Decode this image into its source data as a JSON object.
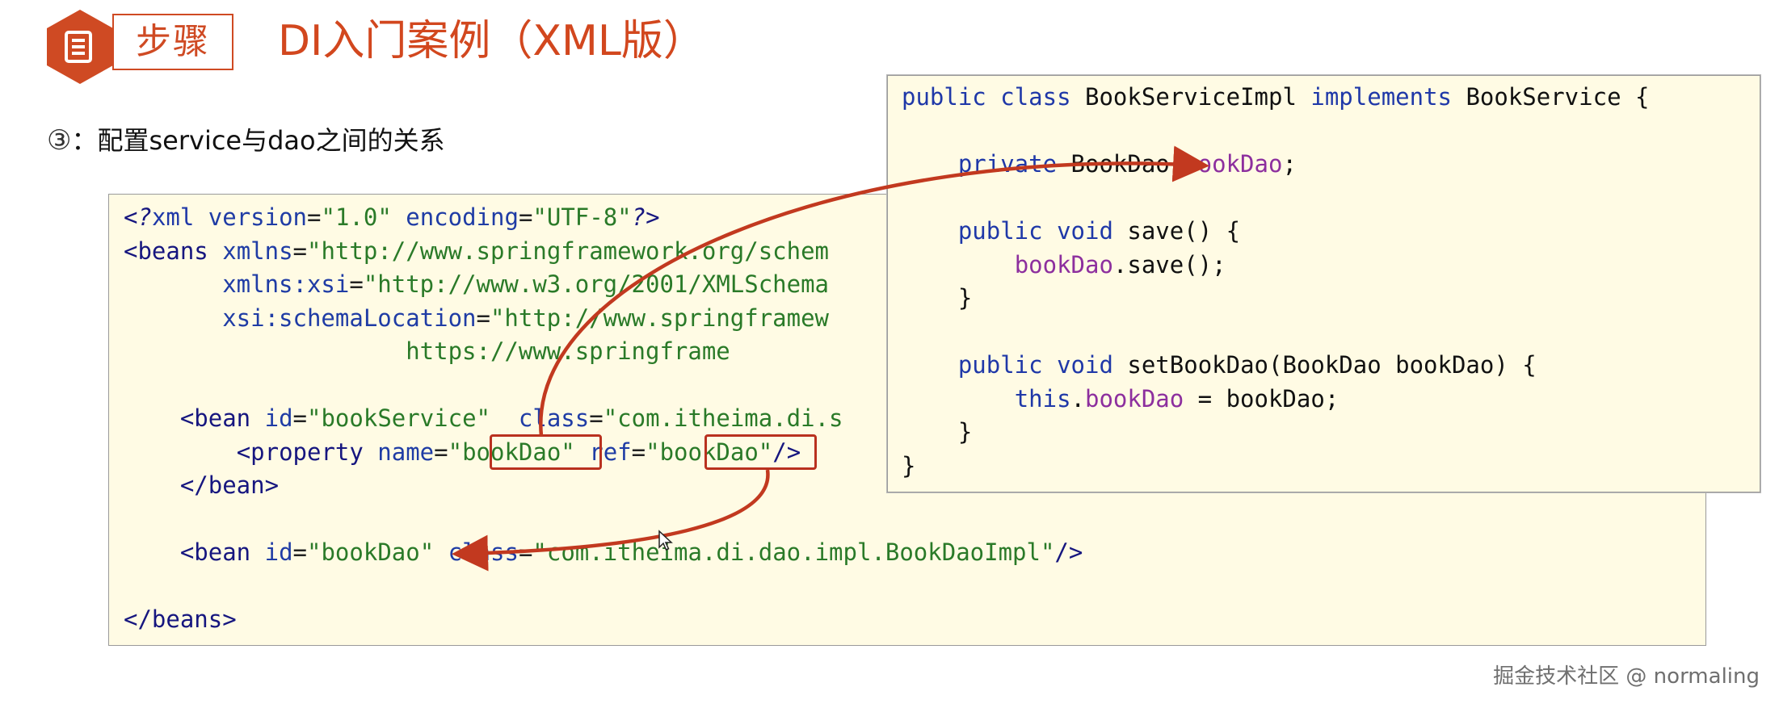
{
  "header": {
    "icon": "document-icon",
    "step_label": "步骤",
    "title": "DI入门案例（XML版）",
    "accent_color": "#cf4a23"
  },
  "step": {
    "marker": "③",
    "text": "：配置service与dao之间的关系"
  },
  "xml_code": {
    "line1": {
      "open": "<",
      "q1": "?",
      "kw": "xml",
      "sp1": " ",
      "a1": "version",
      "eq1": "=",
      "v1": "\"1.0\"",
      "sp2": " ",
      "a2": "encoding",
      "eq2": "=",
      "v2": "\"UTF-8\"",
      "close": "?>"
    },
    "line2": {
      "tag": "<beans",
      "sp": " ",
      "attr": "xmlns",
      "eq": "=",
      "val": "\"http://www.springframework.org/schem"
    },
    "line3": {
      "indent": "       ",
      "attr": "xmlns:xsi",
      "eq": "=",
      "val": "\"http://www.w3.org/2001/XMLSchema"
    },
    "line4": {
      "indent": "       ",
      "attr": "xsi:schemaLocation",
      "eq": "=",
      "val": "\"http://www.springframew"
    },
    "line5": {
      "indent": "                    ",
      "val": "https://www.springframe"
    },
    "line7": {
      "indent": "    ",
      "tag": "<bean",
      "sp1": " ",
      "a1": "id",
      "eq1": "=",
      "v1": "\"bookService\"",
      "sp2": "  ",
      "a2": "class",
      "eq2": "=",
      "v2": "\"com.itheima.di.s"
    },
    "line8": {
      "indent": "        ",
      "tag": "<property",
      "sp1": " ",
      "a1": "name",
      "eq1": "=",
      "q1": "\"",
      "v1": "bookDao",
      "q2": "\"",
      "sp2": " ",
      "a2": "ref",
      "eq2": "=",
      "q3": "\"",
      "v2": "bookDao",
      "q4": "\"",
      "close": "/>"
    },
    "line9": {
      "indent": "    ",
      "tag": "</bean>"
    },
    "line11": {
      "indent": "    ",
      "tag": "<bean",
      "sp1": " ",
      "a1": "id",
      "eq1": "=",
      "v1": "\"bookDao\"",
      "sp2": " ",
      "a2": "class",
      "eq2": "=",
      "v2": "\"com.itheima.di.dao.impl.BookDaoImpl\"",
      "close": "/>"
    },
    "line13": {
      "tag": "</beans>"
    }
  },
  "java_code": {
    "line1": {
      "k1": "public",
      "k2": "class",
      "name": "BookServiceImpl",
      "k3": "implements",
      "iface": "BookService",
      "brace": "{"
    },
    "line3": {
      "indent": "    ",
      "k1": "private",
      "type": "BookDao",
      "field": "bookDao",
      "semi": ";"
    },
    "line5": {
      "indent": "    ",
      "k1": "public",
      "k2": "void",
      "method": "save",
      "rest": "() {"
    },
    "line6": {
      "indent": "        ",
      "field": "bookDao",
      "rest": ".save();"
    },
    "line7": {
      "indent": "    ",
      "text": "}"
    },
    "line9": {
      "indent": "    ",
      "k1": "public",
      "k2": "void",
      "method": "setBookDao",
      "rest": "(BookDao bookDao) {"
    },
    "line10": {
      "indent": "        ",
      "k1": "this",
      "dot": ".",
      "field": "bookDao",
      "rest": " = bookDao;"
    },
    "line11": {
      "indent": "    ",
      "text": "}"
    },
    "line12": {
      "text": "}"
    }
  },
  "annotations": {
    "arrow_color": "#c2391f",
    "highlight_color": "#b9311f"
  },
  "watermark": {
    "text": "掘金技术社区 @ normaling"
  }
}
